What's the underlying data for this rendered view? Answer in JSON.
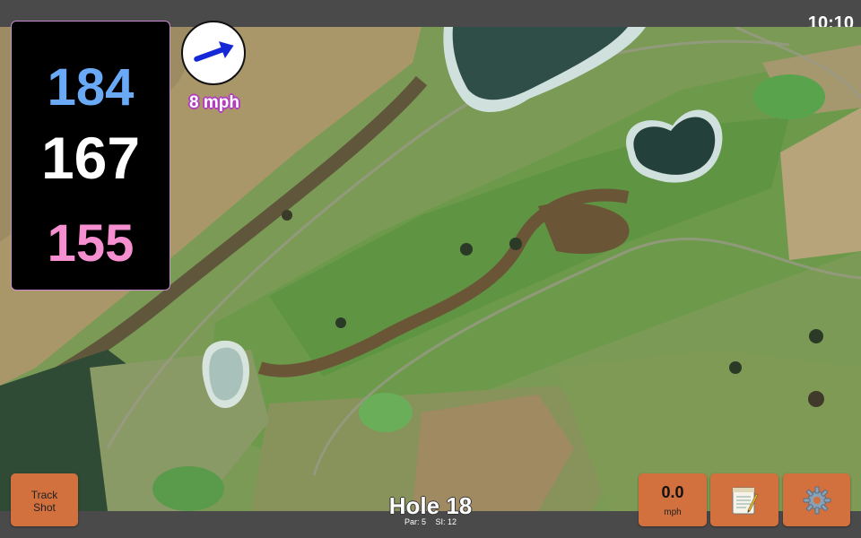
{
  "status_bar": {
    "time": "10:10"
  },
  "yardage": {
    "back": "184",
    "middle": "167",
    "front": "155"
  },
  "wind": {
    "label": "8 mph",
    "direction_icon": "arrow-right-icon"
  },
  "hole": {
    "title": "Hole 18",
    "par": "Par: 5",
    "si": "SI: 12"
  },
  "buttons": {
    "track_shot": {
      "line1": "Track",
      "line2": "Shot"
    },
    "wind_speed": {
      "value": "0.0",
      "unit": "mph"
    },
    "scorecard_icon": "notepad-icon",
    "settings_icon": "gear-icon"
  },
  "colors": {
    "back": "#6aa9f5",
    "middle": "#ffffff",
    "front": "#f58fd0",
    "button": "#d2703e",
    "panel_border": "#c98bd1"
  }
}
